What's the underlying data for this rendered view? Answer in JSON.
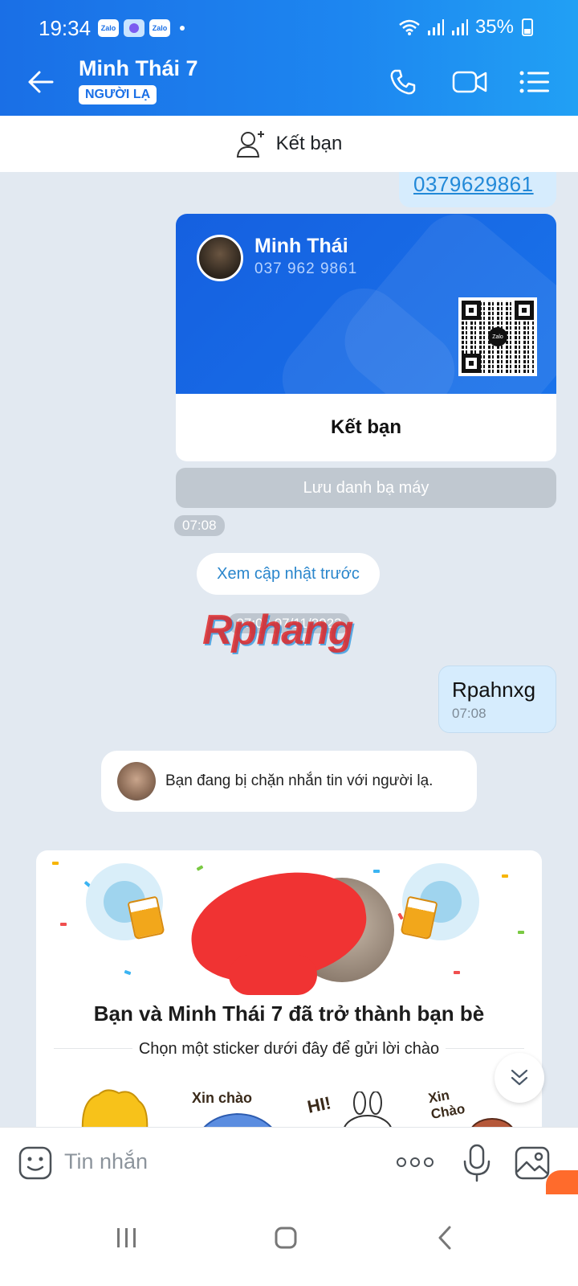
{
  "status_bar": {
    "time": "19:34",
    "battery": "35%",
    "app_icons": [
      "Zalo",
      "Zalo"
    ]
  },
  "header": {
    "contact_name": "Minh Thái 7",
    "badge": "NGƯỜI LẠ"
  },
  "add_friend_strip": {
    "label": "Kết bạn"
  },
  "chat": {
    "phone_number": "0379629861",
    "contact_card": {
      "name": "Minh Thái",
      "phone": "037 962 9861",
      "action_label": "Kết bạn",
      "qr_logo": "Zalo"
    },
    "save_contact_label": "Lưu danh bạ máy",
    "card_time": "07:08",
    "see_previous_label": "Xem cập nhật trước",
    "date_separator": "07:08 07/11/2023",
    "watermark": "Rphang",
    "my_message": {
      "text": "Rpahnxg",
      "time": "07:08"
    },
    "notice": "Bạn đang bị chặn nhắn tin với người lạ.",
    "friend_card": {
      "title": "Bạn và Minh Thái 7 đã trở thành bạn bè",
      "subtitle": "Chọn một sticker dưới đây để gửi lời chào",
      "stickers": [
        "",
        "Xin chào",
        "HI!",
        "Xin Chào"
      ]
    }
  },
  "input_bar": {
    "placeholder": "Tin nhắn"
  },
  "colors": {
    "header_blue": "#1a6fe6",
    "my_bubble": "#d6ecfd",
    "link": "#2289d8",
    "background": "#e2e9f1"
  }
}
